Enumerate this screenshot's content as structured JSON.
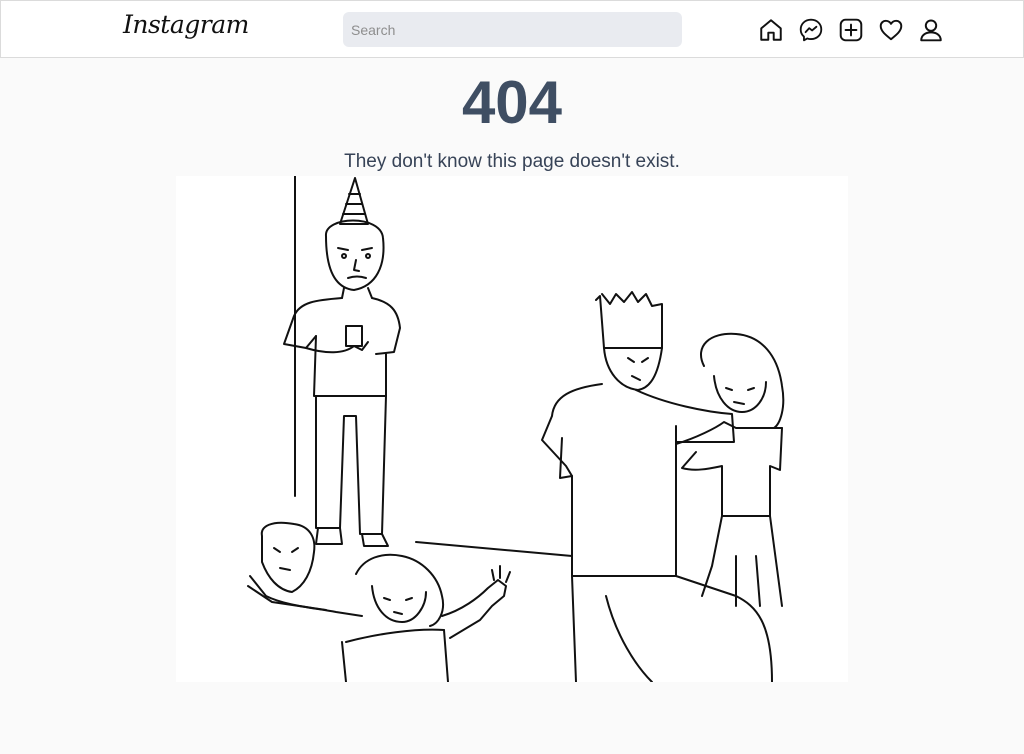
{
  "header": {
    "logo_text": "Instagram",
    "search_placeholder": "Search",
    "search_value": "",
    "icons": [
      "home-icon",
      "messenger-icon",
      "new-post-icon",
      "heart-icon",
      "profile-icon"
    ]
  },
  "error": {
    "code": "404",
    "message": "They don't know this page doesn't exist."
  },
  "colors": {
    "page_background": "#fafafa",
    "header_background": "#ffffff",
    "search_background": "#e9ebf0",
    "heading_color": "#3f4e63",
    "text_color": "#374357"
  }
}
